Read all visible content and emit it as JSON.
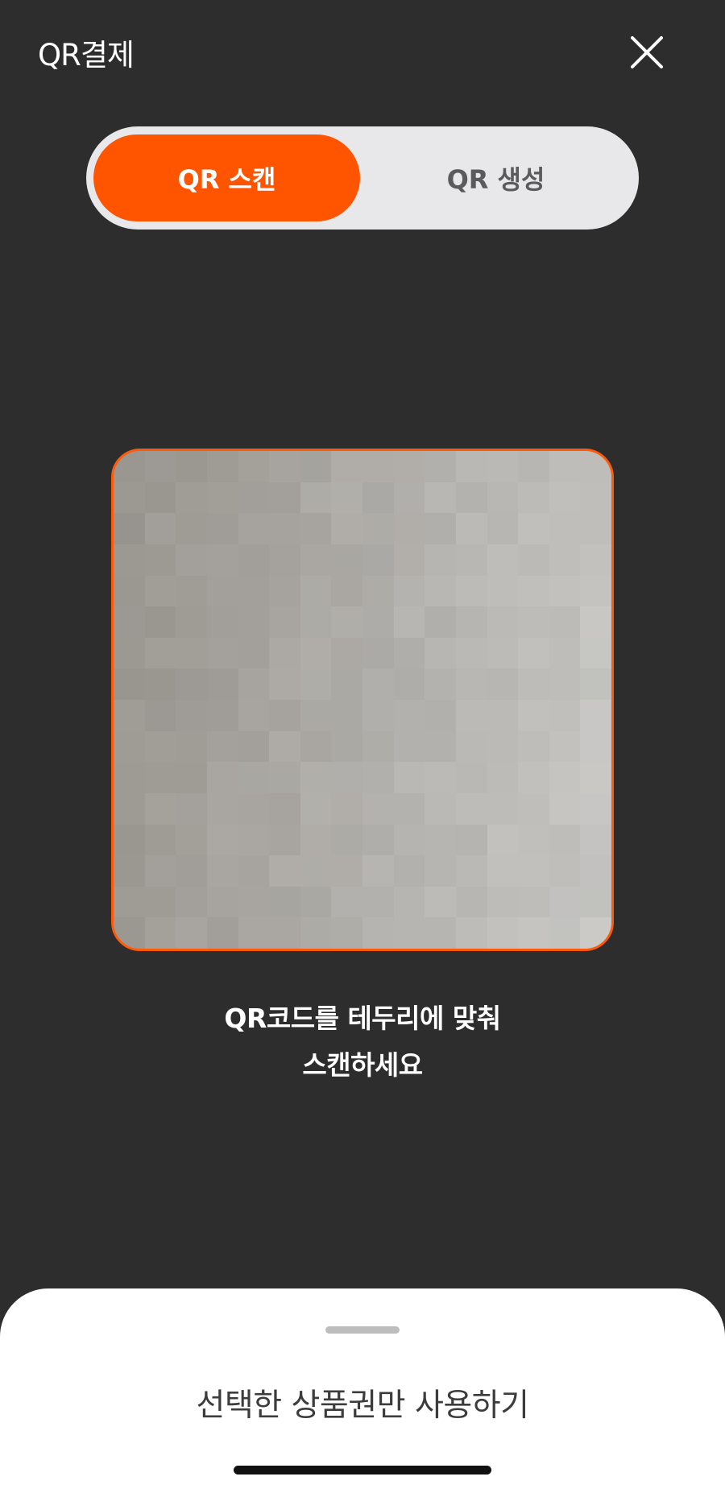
{
  "header": {
    "title": "QR결제",
    "close_icon": "close-icon"
  },
  "tabs": [
    {
      "label": "QR 스캔",
      "active": true
    },
    {
      "label": "QR 생성",
      "active": false
    }
  ],
  "scanner": {
    "instruction_line1": "QR코드를 테두리에 맞춰",
    "instruction_line2": "스캔하세요"
  },
  "bottom_sheet": {
    "option_label": "선택한 상품권만 사용하기"
  },
  "colors": {
    "accent": "#ff5500",
    "background": "#2d2d2d",
    "segment_bg": "#e8e8ea"
  }
}
